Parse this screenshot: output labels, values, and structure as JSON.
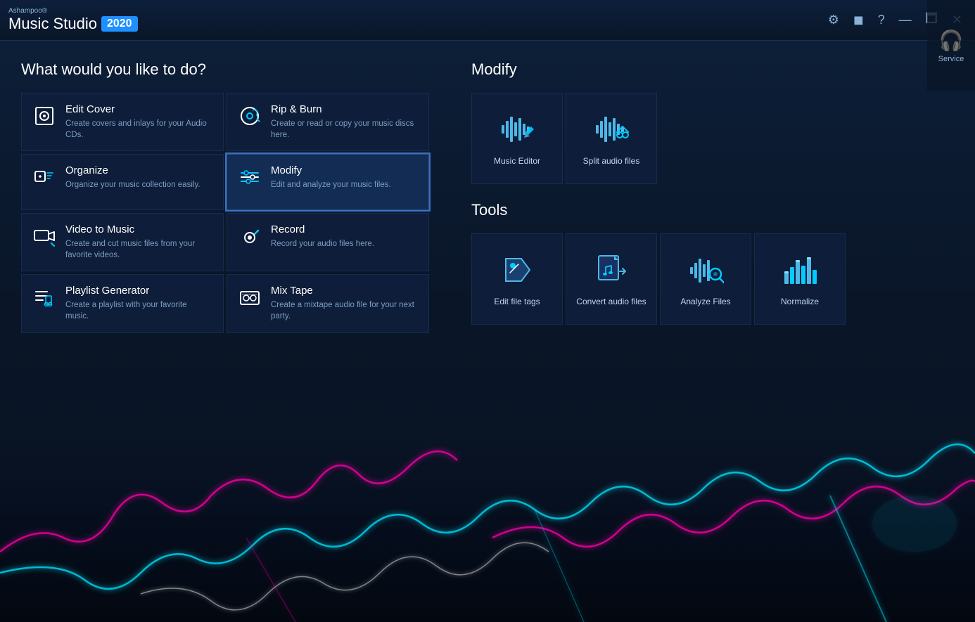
{
  "app": {
    "brand": "Ashampoo®",
    "name": "Music Studio",
    "year": "2020"
  },
  "titlebar": {
    "controls": {
      "settings": "⚙",
      "theme": "🖤",
      "help": "?",
      "minimize": "—",
      "restore": "🗖",
      "close": "✕"
    }
  },
  "service": {
    "icon": "🎧",
    "label": "Service"
  },
  "main": {
    "question": "What would you like to do?",
    "left_cards": [
      {
        "id": "edit-cover",
        "title": "Edit Cover",
        "desc": "Create covers and inlays for your Audio CDs.",
        "icon_type": "edit-cover"
      },
      {
        "id": "rip-burn",
        "title": "Rip & Burn",
        "desc": "Create or read or copy your music discs here.",
        "icon_type": "rip-burn"
      },
      {
        "id": "organize",
        "title": "Organize",
        "desc": "Organize your music collection easily.",
        "icon_type": "organize"
      },
      {
        "id": "modify",
        "title": "Modify",
        "desc": "Edit and analyze your music files.",
        "icon_type": "modify",
        "active": true
      },
      {
        "id": "video-to-music",
        "title": "Video to Music",
        "desc": "Create and cut music files from your favorite videos.",
        "icon_type": "video-to-music"
      },
      {
        "id": "record",
        "title": "Record",
        "desc": "Record your audio files here.",
        "icon_type": "record"
      },
      {
        "id": "playlist-generator",
        "title": "Playlist Generator",
        "desc": "Create a playlist with your favorite music.",
        "icon_type": "playlist-generator"
      },
      {
        "id": "mix-tape",
        "title": "Mix Tape",
        "desc": "Create a mixtape audio file for your next party.",
        "icon_type": "mix-tape"
      }
    ],
    "modify_section": {
      "title": "Modify",
      "cards": [
        {
          "id": "music-editor",
          "label": "Music Editor",
          "icon_type": "music-editor"
        },
        {
          "id": "split-audio",
          "label": "Split audio files",
          "icon_type": "split-audio"
        }
      ]
    },
    "tools_section": {
      "title": "Tools",
      "cards": [
        {
          "id": "edit-file-tags",
          "label": "Edit file tags",
          "icon_type": "edit-file-tags"
        },
        {
          "id": "convert-audio",
          "label": "Convert audio files",
          "icon_type": "convert-audio"
        },
        {
          "id": "analyze-files",
          "label": "Analyze Files",
          "icon_type": "analyze-files"
        },
        {
          "id": "normalize",
          "label": "Normalize",
          "icon_type": "normalize"
        }
      ]
    }
  }
}
